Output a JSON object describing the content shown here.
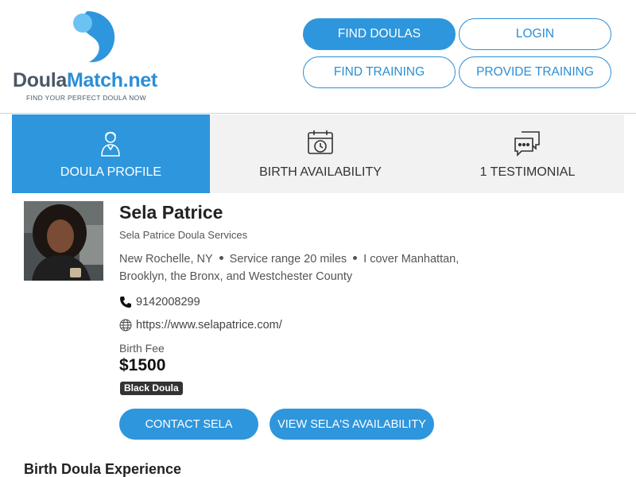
{
  "brand": {
    "name_part1": "Doula",
    "name_part2": "Match.net",
    "tagline": "FIND YOUR PERFECT DOULA NOW",
    "colors": {
      "primary": "#2e96dc",
      "accent_light": "#5fb8f0",
      "text_dark": "#4a5867"
    }
  },
  "nav": {
    "find_doulas": "FIND DOULAS",
    "login": "LOGIN",
    "find_training": "FIND TRAINING",
    "provide_training": "PROVIDE TRAINING"
  },
  "tabs": [
    {
      "label": "DOULA PROFILE",
      "icon": "person-icon",
      "active": true
    },
    {
      "label": "BIRTH AVAILABILITY",
      "icon": "calendar-clock-icon",
      "active": false
    },
    {
      "label": "1 TESTIMONIAL",
      "icon": "chat-bubbles-icon",
      "active": false
    }
  ],
  "profile": {
    "name": "Sela Patrice",
    "business": "Sela Patrice Doula Services",
    "city": "New Rochelle, NY",
    "service_range": "Service range 20 miles",
    "coverage_line1": "I cover Manhattan,",
    "coverage_line2": "Brooklyn, the Bronx, and Westchester County",
    "phone": "9142008299",
    "website": "https://www.selapatrice.com/",
    "fee_label": "Birth Fee",
    "fee_value": "$1500",
    "badge": "Black Doula",
    "contact_button": "CONTACT SELA",
    "availability_button": "VIEW SELA'S AVAILABILITY"
  },
  "sections": {
    "experience_title": "Birth Doula Experience"
  }
}
